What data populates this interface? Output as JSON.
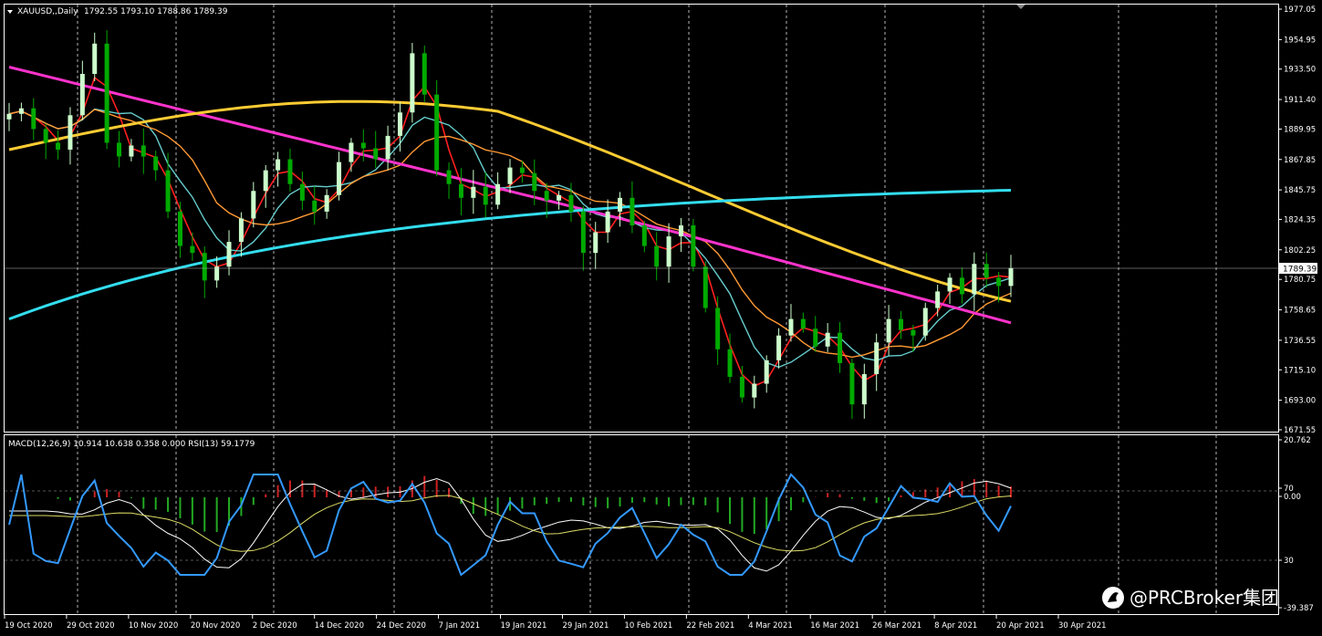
{
  "main_panel": {
    "symbol": "XAUUSD,,Daily",
    "ohlc": "1792.55 1793.10 1788.86 1789.39",
    "current_price": "1789.39",
    "price_ticks": [
      "1977.05",
      "1954.95",
      "1933.50",
      "1911.40",
      "1889.95",
      "1867.85",
      "1845.75",
      "1824.35",
      "1802.25",
      "1780.75",
      "1758.65",
      "1736.55",
      "1715.10",
      "1693.00",
      "1671.55"
    ]
  },
  "sub_panel": {
    "header": "MACD(12,26,9) 10.914 10.638 0.358 0.000  RSI(13) 59.1779",
    "ticks": [
      "20.762",
      "70",
      "0.00",
      "30",
      "-39.387"
    ]
  },
  "time_axis": [
    "19 Oct 2020",
    "29 Oct 2020",
    "10 Nov 2020",
    "20 Nov 2020",
    "2 Dec 2020",
    "14 Dec 2020",
    "24 Dec 2020",
    "7 Jan 2021",
    "19 Jan 2021",
    "29 Jan 2021",
    "10 Feb 2021",
    "22 Feb 2021",
    "4 Mar 2021",
    "16 Mar 2021",
    "26 Mar 2021",
    "8 Apr 2021",
    "20 Apr 2021",
    "30 Apr 2021"
  ],
  "watermark": "@PRCBroker集团",
  "colors": {
    "bull_candle": "#ccffcc",
    "bear_candle": "#00aa00",
    "ma_fast": "#ff2020",
    "ma_mid": "#66cccc",
    "ma_slow": "#ff9933",
    "ma_100": "#ff33cc",
    "ma_150": "#ffcc33",
    "ma_200": "#33ddee",
    "macd_pos": "#cc2222",
    "macd_neg": "#22aa22",
    "macd_line": "#ffffff",
    "signal_line": "#dddd66",
    "rsi_line": "#3399ff",
    "grid": "#ffffff",
    "border": "#ffffff"
  },
  "chart_data": {
    "type": "candlestick",
    "series": [
      {
        "name": "XAUUSD",
        "close_path": [
          1901,
          1905,
          1890,
          1880,
          1875,
          1900,
          1930,
          1952,
          1880,
          1870,
          1878,
          1870,
          1860,
          1830,
          1805,
          1800,
          1780,
          1790,
          1808,
          1825,
          1845,
          1860,
          1868,
          1850,
          1838,
          1830,
          1842,
          1866,
          1880,
          1876,
          1868,
          1885,
          1902,
          1945,
          1915,
          1860,
          1850,
          1840,
          1848,
          1835,
          1850,
          1862,
          1858,
          1845,
          1838,
          1842,
          1830,
          1800,
          1815,
          1830,
          1840,
          1820,
          1805,
          1790,
          1812,
          1820,
          1790,
          1760,
          1730,
          1710,
          1695,
          1705,
          1722,
          1740,
          1752,
          1745,
          1732,
          1742,
          1720,
          1690,
          1712,
          1735,
          1752,
          1744,
          1740,
          1760,
          1772,
          1782,
          1770,
          1792,
          1782,
          1776,
          1789
        ]
      }
    ],
    "y_range": [
      1671.55,
      1977.05
    ]
  }
}
